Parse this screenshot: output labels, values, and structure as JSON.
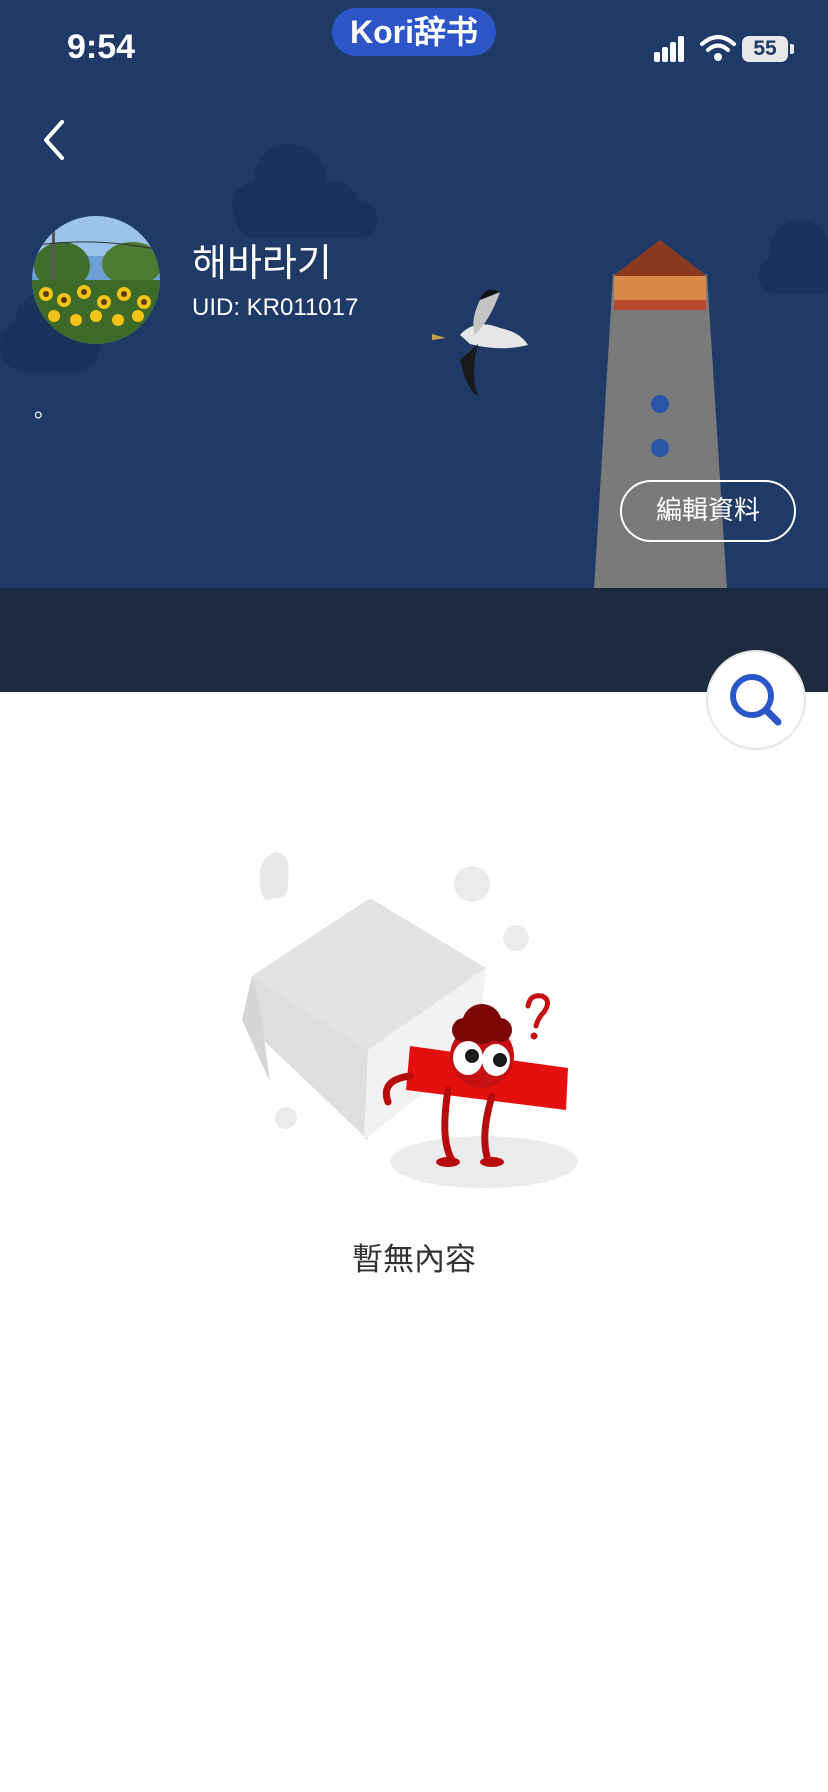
{
  "status_bar": {
    "time": "9:54",
    "app_pill": "Kori辞书",
    "battery": "55"
  },
  "profile": {
    "username": "해바라기",
    "uid": "UID: KR011017",
    "bio": "。",
    "edit_button": "編輯資料"
  },
  "empty_state": {
    "message": "暫無內容"
  },
  "colors": {
    "header_bg": "#1f3a66",
    "accent": "#2c55c7",
    "mascot": "#e41010"
  }
}
